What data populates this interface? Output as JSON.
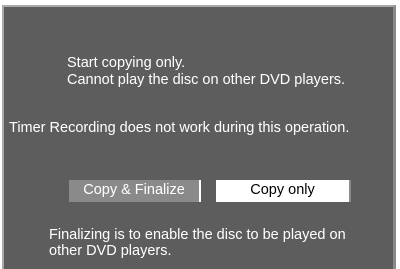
{
  "dialog": {
    "message_lines": [
      "Start copying only.",
      "Cannot play the disc on other DVD players."
    ],
    "timer_warning": "Timer Recording does not work during this operation.",
    "options": [
      {
        "label": "Copy & Finalize",
        "selected": false
      },
      {
        "label": "Copy only",
        "selected": true
      }
    ],
    "note_lines": [
      "Finalizing is to enable the disc to be played on",
      "other DVD players."
    ]
  },
  "colors": {
    "dialog_background": "#5d5d5d",
    "unselected_button": "#8a8a8a",
    "selected_button": "#ffffff",
    "text": "#ffffff"
  }
}
